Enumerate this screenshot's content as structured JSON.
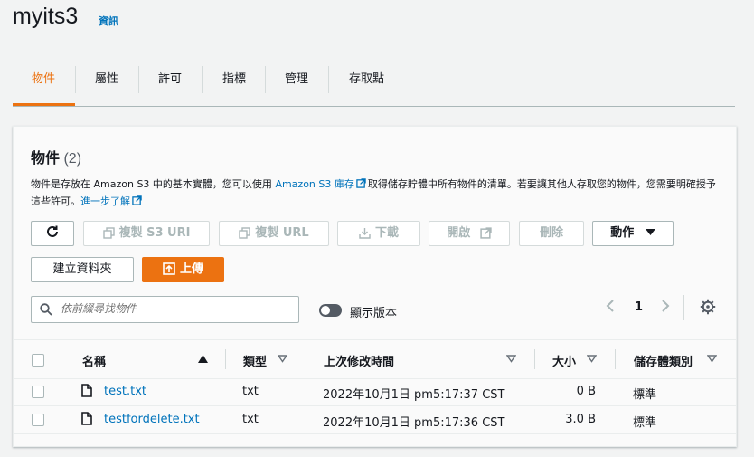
{
  "header": {
    "title": "myits3",
    "info_link": "資訊"
  },
  "tabs": [
    {
      "label": "物件",
      "active": true
    },
    {
      "label": "屬性"
    },
    {
      "label": "許可"
    },
    {
      "label": "指標"
    },
    {
      "label": "管理"
    },
    {
      "label": "存取點"
    }
  ],
  "panel": {
    "heading": "物件",
    "count": "(2)",
    "desc_part1": "物件是存放在 Amazon S3 中的基本實體，您可以使用 ",
    "desc_link1": "Amazon S3 庫存",
    "desc_part2": "取得儲存貯體中所有物件的清單。若要讓其他人存取您的物件，您需要明確授予這些許可。",
    "desc_link2": "進一步了解"
  },
  "toolbar": {
    "refresh_icon": "refresh-icon",
    "copy_s3_uri": "複製 S3 URI",
    "copy_url": "複製 URL",
    "download": "下載",
    "open": "開啟",
    "delete": "刪除",
    "actions": "動作",
    "create_folder": "建立資料夾",
    "upload": "上傳"
  },
  "search": {
    "placeholder": "依前綴尋找物件",
    "value": ""
  },
  "toggle": {
    "label": "顯示版本",
    "on": false
  },
  "pagination": {
    "page": "1"
  },
  "table": {
    "headers": {
      "name": "名稱",
      "type": "類型",
      "modified": "上次修改時間",
      "size": "大小",
      "storage_class": "儲存體類別"
    },
    "rows": [
      {
        "name": "test.txt",
        "type": "txt",
        "modified": "2022年10月1日 pm5:17:37 CST",
        "size": "0 B",
        "storage_class": "標準"
      },
      {
        "name": "testfordelete.txt",
        "type": "txt",
        "modified": "2022年10月1日 pm5:17:36 CST",
        "size": "3.0 B",
        "storage_class": "標準"
      }
    ]
  },
  "colors": {
    "accent": "#ec7211",
    "link": "#0073bb",
    "text": "#16191f",
    "border": "#aab7b8"
  }
}
